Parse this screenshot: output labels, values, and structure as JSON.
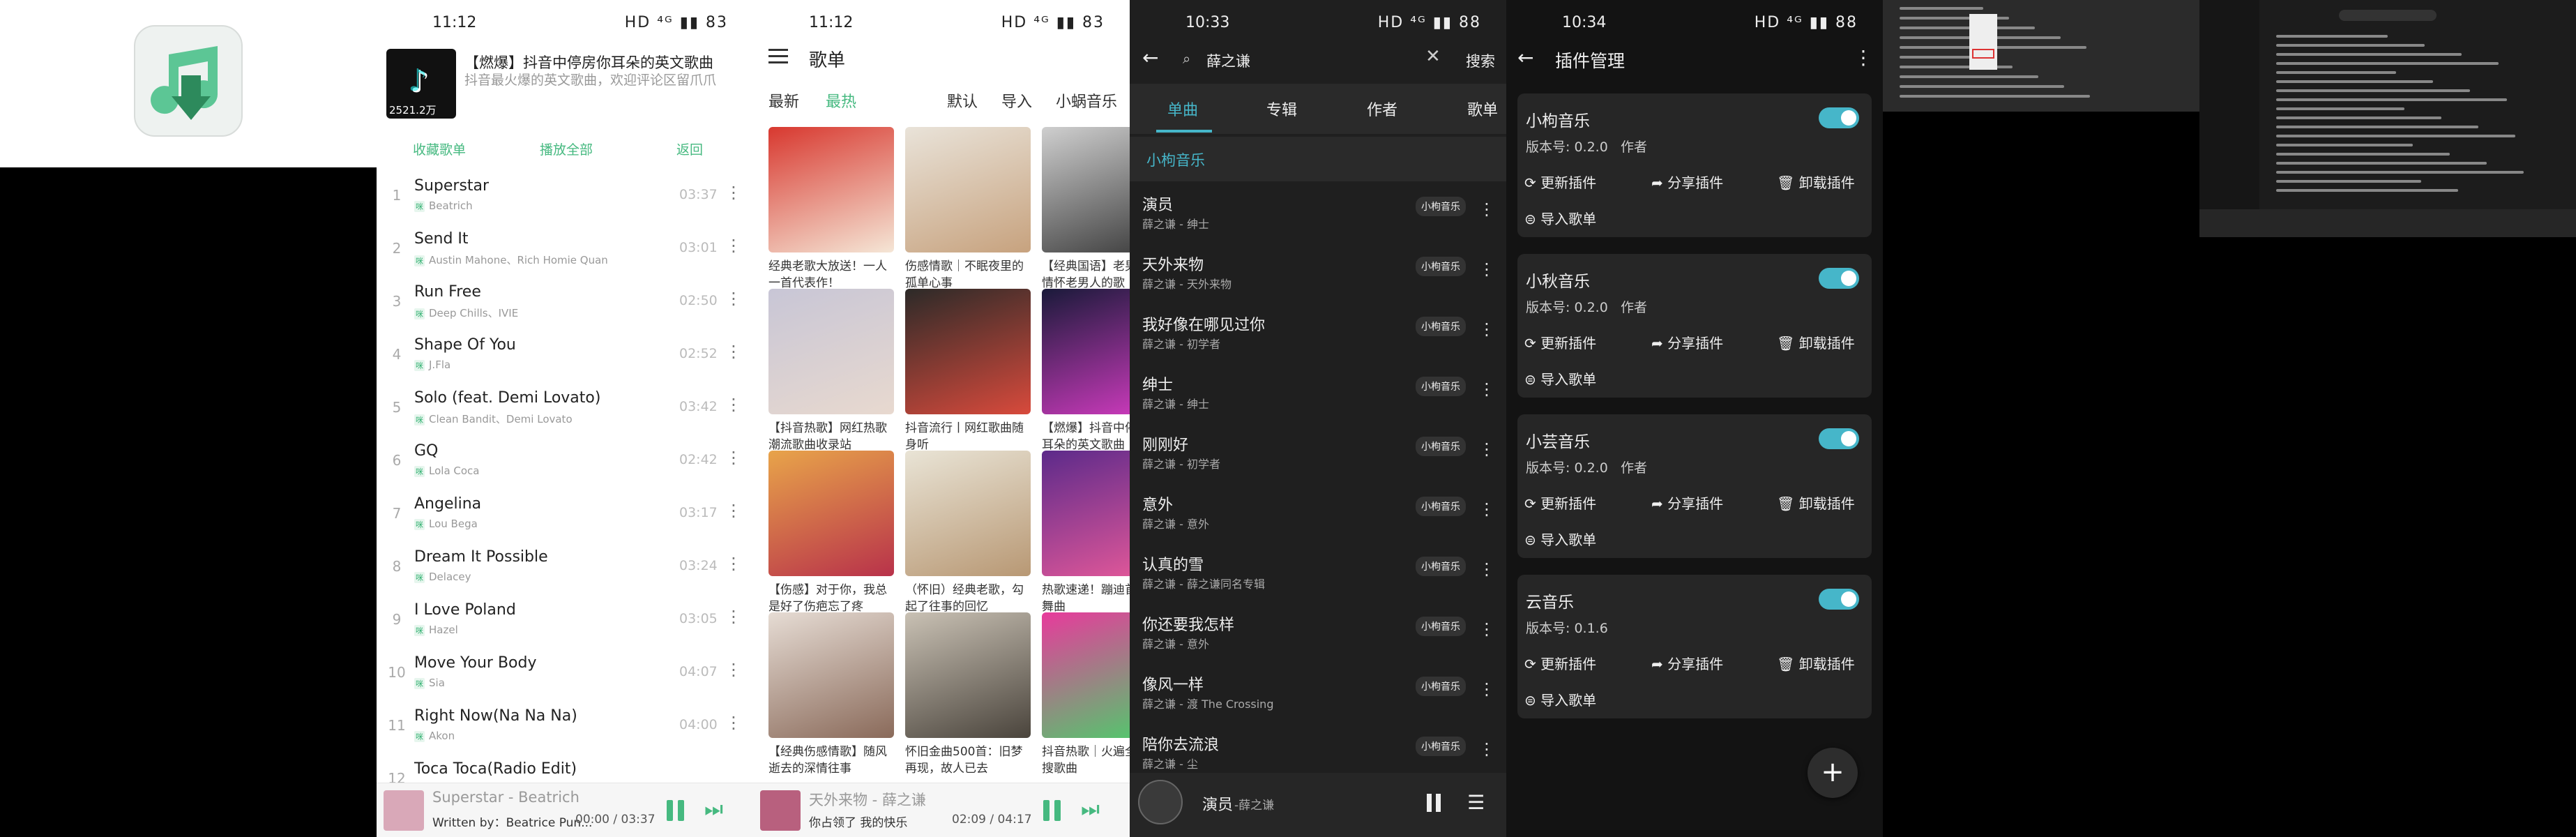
{
  "p1": {
    "status": {
      "time": "11:12",
      "icons": "HD ⁴ᴳ ▮▮ 83"
    },
    "header": {
      "title": "【燃爆】抖音中停房你耳朵的英文歌曲",
      "desc": "抖音最火爆的英文歌曲，欢迎评论区留爪爪",
      "count": "2521.2万"
    },
    "actions": {
      "collect": "收藏歌单",
      "play_all": "播放全部",
      "back": "返回"
    },
    "tracks": [
      {
        "n": "1",
        "name": "Superstar",
        "artist": "Beatrich",
        "dur": "03:37"
      },
      {
        "n": "2",
        "name": "Send It",
        "artist": "Austin Mahone、Rich Homie Quan",
        "dur": "03:01"
      },
      {
        "n": "3",
        "name": "Run Free",
        "artist": "Deep Chills、IVIE",
        "dur": "02:50"
      },
      {
        "n": "4",
        "name": "Shape Of You",
        "artist": "J.Fla",
        "dur": "02:52"
      },
      {
        "n": "5",
        "name": "Solo (feat. Demi Lovato)",
        "artist": "Clean Bandit、Demi Lovato",
        "dur": "03:42"
      },
      {
        "n": "6",
        "name": "GQ",
        "artist": "Lola Coca",
        "dur": "02:42"
      },
      {
        "n": "7",
        "name": "Angelina",
        "artist": "Lou Bega",
        "dur": "03:17"
      },
      {
        "n": "8",
        "name": "Dream It Possible",
        "artist": "Delacey",
        "dur": "03:24"
      },
      {
        "n": "9",
        "name": "I Love Poland",
        "artist": "Hazel",
        "dur": "03:05"
      },
      {
        "n": "10",
        "name": "Move Your Body",
        "artist": "Sia",
        "dur": "04:07"
      },
      {
        "n": "11",
        "name": "Right Now(Na Na Na)",
        "artist": "Akon",
        "dur": "04:00"
      },
      {
        "n": "12",
        "name": "Toca Toca(Radio Edit)",
        "artist": "",
        "dur": ""
      }
    ],
    "source_tag": "咪",
    "player": {
      "title": "Superstar - Beatrich",
      "lyric": "Written by：Beatrice Pun...",
      "time": "00:00 / 03:37"
    }
  },
  "p2": {
    "status": {
      "time": "11:12",
      "icons": "HD ⁴ᴳ ▮▮ 83"
    },
    "title": "歌单",
    "tabs": [
      "最新",
      "最热"
    ],
    "sorts": [
      "默认",
      "导入"
    ],
    "source": "小蜗音乐",
    "cards": [
      {
        "cap": "经典老歌大放送！一人一首代表作！",
        "c1": "#d8382f",
        "c2": "#f5e6d6"
      },
      {
        "cap": "伤感情歌｜不眠夜里的孤单心事",
        "c1": "#e9e3d9",
        "c2": "#c7a27e"
      },
      {
        "cap": "【经典国语】老男人的情怀老男人的歌",
        "c1": "#cfcfcf",
        "c2": "#3a3a3a"
      },
      {
        "cap": "【抖音热歌】网红热歌潮流歌曲收录站",
        "c1": "#c8c6d6",
        "c2": "#e8d9cf"
      },
      {
        "cap": "抖音流行丨网红歌曲随身听",
        "c1": "#2c2a28",
        "c2": "#d84a3c"
      },
      {
        "cap": "【燃爆】抖音中停房你耳朵的英文歌曲",
        "c1": "#1a1a3a",
        "c2": "#d43cc2"
      },
      {
        "cap": "【伤感】对于你，我总是好了伤疤忘了疼",
        "c1": "#e8a44a",
        "c2": "#b8324a"
      },
      {
        "cap": "（怀旧）经典老歌，勾起了往事的回忆",
        "c1": "#e9e4d6",
        "c2": "#b89874"
      },
      {
        "cap": "热歌速递！蹦迪首选DJ舞曲",
        "c1": "#5c2a8a",
        "c2": "#e85a9a"
      },
      {
        "cap": "【经典伤感情歌】随风逝去的深情往事",
        "c1": "#e6dcd4",
        "c2": "#8a6a5a"
      },
      {
        "cap": "怀旧金曲500首：旧梦再现，故人已去",
        "c1": "#c9c1b4",
        "c2": "#4a443c"
      },
      {
        "cap": "抖音热歌｜火遍全网热搜歌曲",
        "c1": "#e83a9c",
        "c2": "#4acf6a"
      }
    ],
    "player": {
      "title": "天外来物 - 薛之谦",
      "lyric": "你占领了 我的快乐",
      "time": "02:09 / 04:17"
    }
  },
  "p3": {
    "status": {
      "time": "10:33",
      "icons": "HD ⁴ᴳ ▮▮ 88"
    },
    "search": {
      "value": "薛之谦",
      "btn": "搜索"
    },
    "tabs": [
      "单曲",
      "专辑",
      "作者",
      "歌单"
    ],
    "source": "小枸音乐",
    "tag": "小枸音乐",
    "results": [
      {
        "name": "演员",
        "sub": "薛之谦 - 绅士"
      },
      {
        "name": "天外来物",
        "sub": "薛之谦 - 天外来物"
      },
      {
        "name": "我好像在哪见过你",
        "sub": "薛之谦 - 初学者"
      },
      {
        "name": "绅士",
        "sub": "薛之谦 - 绅士"
      },
      {
        "name": "刚刚好",
        "sub": "薛之谦 - 初学者"
      },
      {
        "name": "意外",
        "sub": "薛之谦 - 意外"
      },
      {
        "name": "认真的雪",
        "sub": "薛之谦 - 薛之谦同名专辑"
      },
      {
        "name": "你还要我怎样",
        "sub": "薛之谦 - 意外"
      },
      {
        "name": "像风一样",
        "sub": "薛之谦 - 渡 The Crossing"
      },
      {
        "name": "陪你去流浪",
        "sub": "薛之谦 - 尘"
      }
    ],
    "player": {
      "title": "演员",
      "artist": "-薛之谦"
    }
  },
  "p4": {
    "status": {
      "time": "10:34",
      "icons": "HD ⁴ᴳ ▮▮ 88"
    },
    "title": "插件管理",
    "plugins": [
      {
        "name": "小枸音乐",
        "ver": "版本号: 0.2.0",
        "author": "作者"
      },
      {
        "name": "小秋音乐",
        "ver": "版本号: 0.2.0",
        "author": "作者"
      },
      {
        "name": "小芸音乐",
        "ver": "版本号: 0.2.0",
        "author": "作者"
      },
      {
        "name": "云音乐",
        "ver": "版本号: 0.1.6",
        "author": ""
      }
    ],
    "btns": {
      "update": "更新插件",
      "share": "分享插件",
      "uninstall": "卸载插件",
      "import": "导入歌单"
    },
    "fab": "+"
  },
  "colors": {
    "green": "#46b980",
    "accent": "#46b6c9"
  }
}
